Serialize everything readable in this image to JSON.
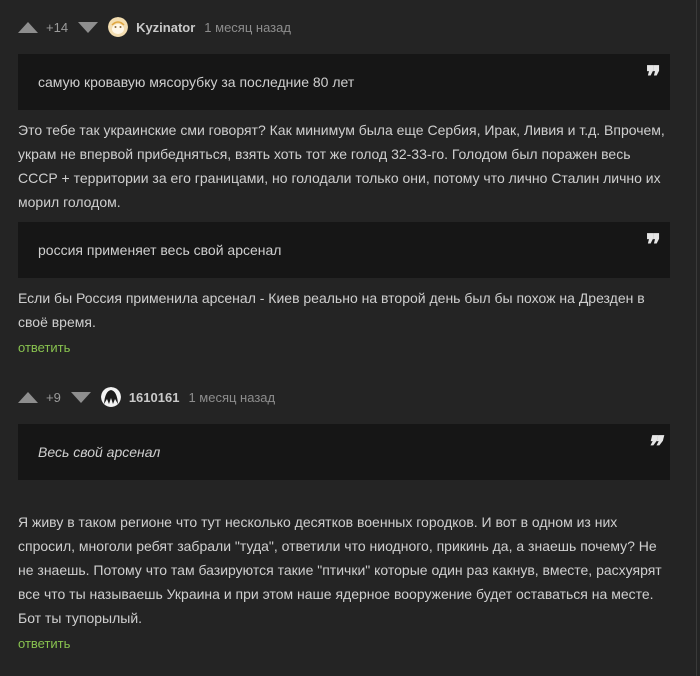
{
  "comments": [
    {
      "rating": "+14",
      "username": "Kyzinator",
      "time": "1 месяц назад",
      "quote1": "самую кровавую мясорубку за последние 80 лет",
      "text1": "Это тебе так украинские сми говорят? Как минимум была еще Сербия, Ирак, Ливия и т.д. Впрочем, укрaм не впервой прибедняться, взять хоть тот же голод 32-33-го. Голодом был поражен весь СССР + территории за его границами, но голодали только они, потому что лично Сталин лично их морил голодом.",
      "quote2": "россия применяет весь свой арсенал",
      "text2": "Если бы Россия применила арсенал - Киев реально на второй день был бы похож на Дрезден в своё время.",
      "reply": "ответить"
    },
    {
      "rating": "+9",
      "username": "1610161",
      "time": "1 месяц назад",
      "quote1": "Весь свой арсенал",
      "text1": "Я живу в таком регионе что тут несколько десятков военных городков. И вот в одном из них спросил, многоли ребят забрали \"туда\", ответили что ниодного, прикинь да, а знаешь почему? Не не знаешь. Потому что там базируются такие \"птички\" которые один раз какнув, вместе, расхуярят все что ты называешь Украина и при этом наше ядерное вооружение будет оставаться на месте. Бот ты тупорылый.",
      "reply": "ответить"
    }
  ],
  "quote_mark": "❞",
  "colors": {
    "background": "#242424",
    "quote_bg": "#161616",
    "reply_link": "#88c24f",
    "text": "#cfcfcf"
  },
  "icons": {
    "upvote": "triangle-up",
    "downvote": "triangle-down",
    "quote": "quotation-mark"
  }
}
